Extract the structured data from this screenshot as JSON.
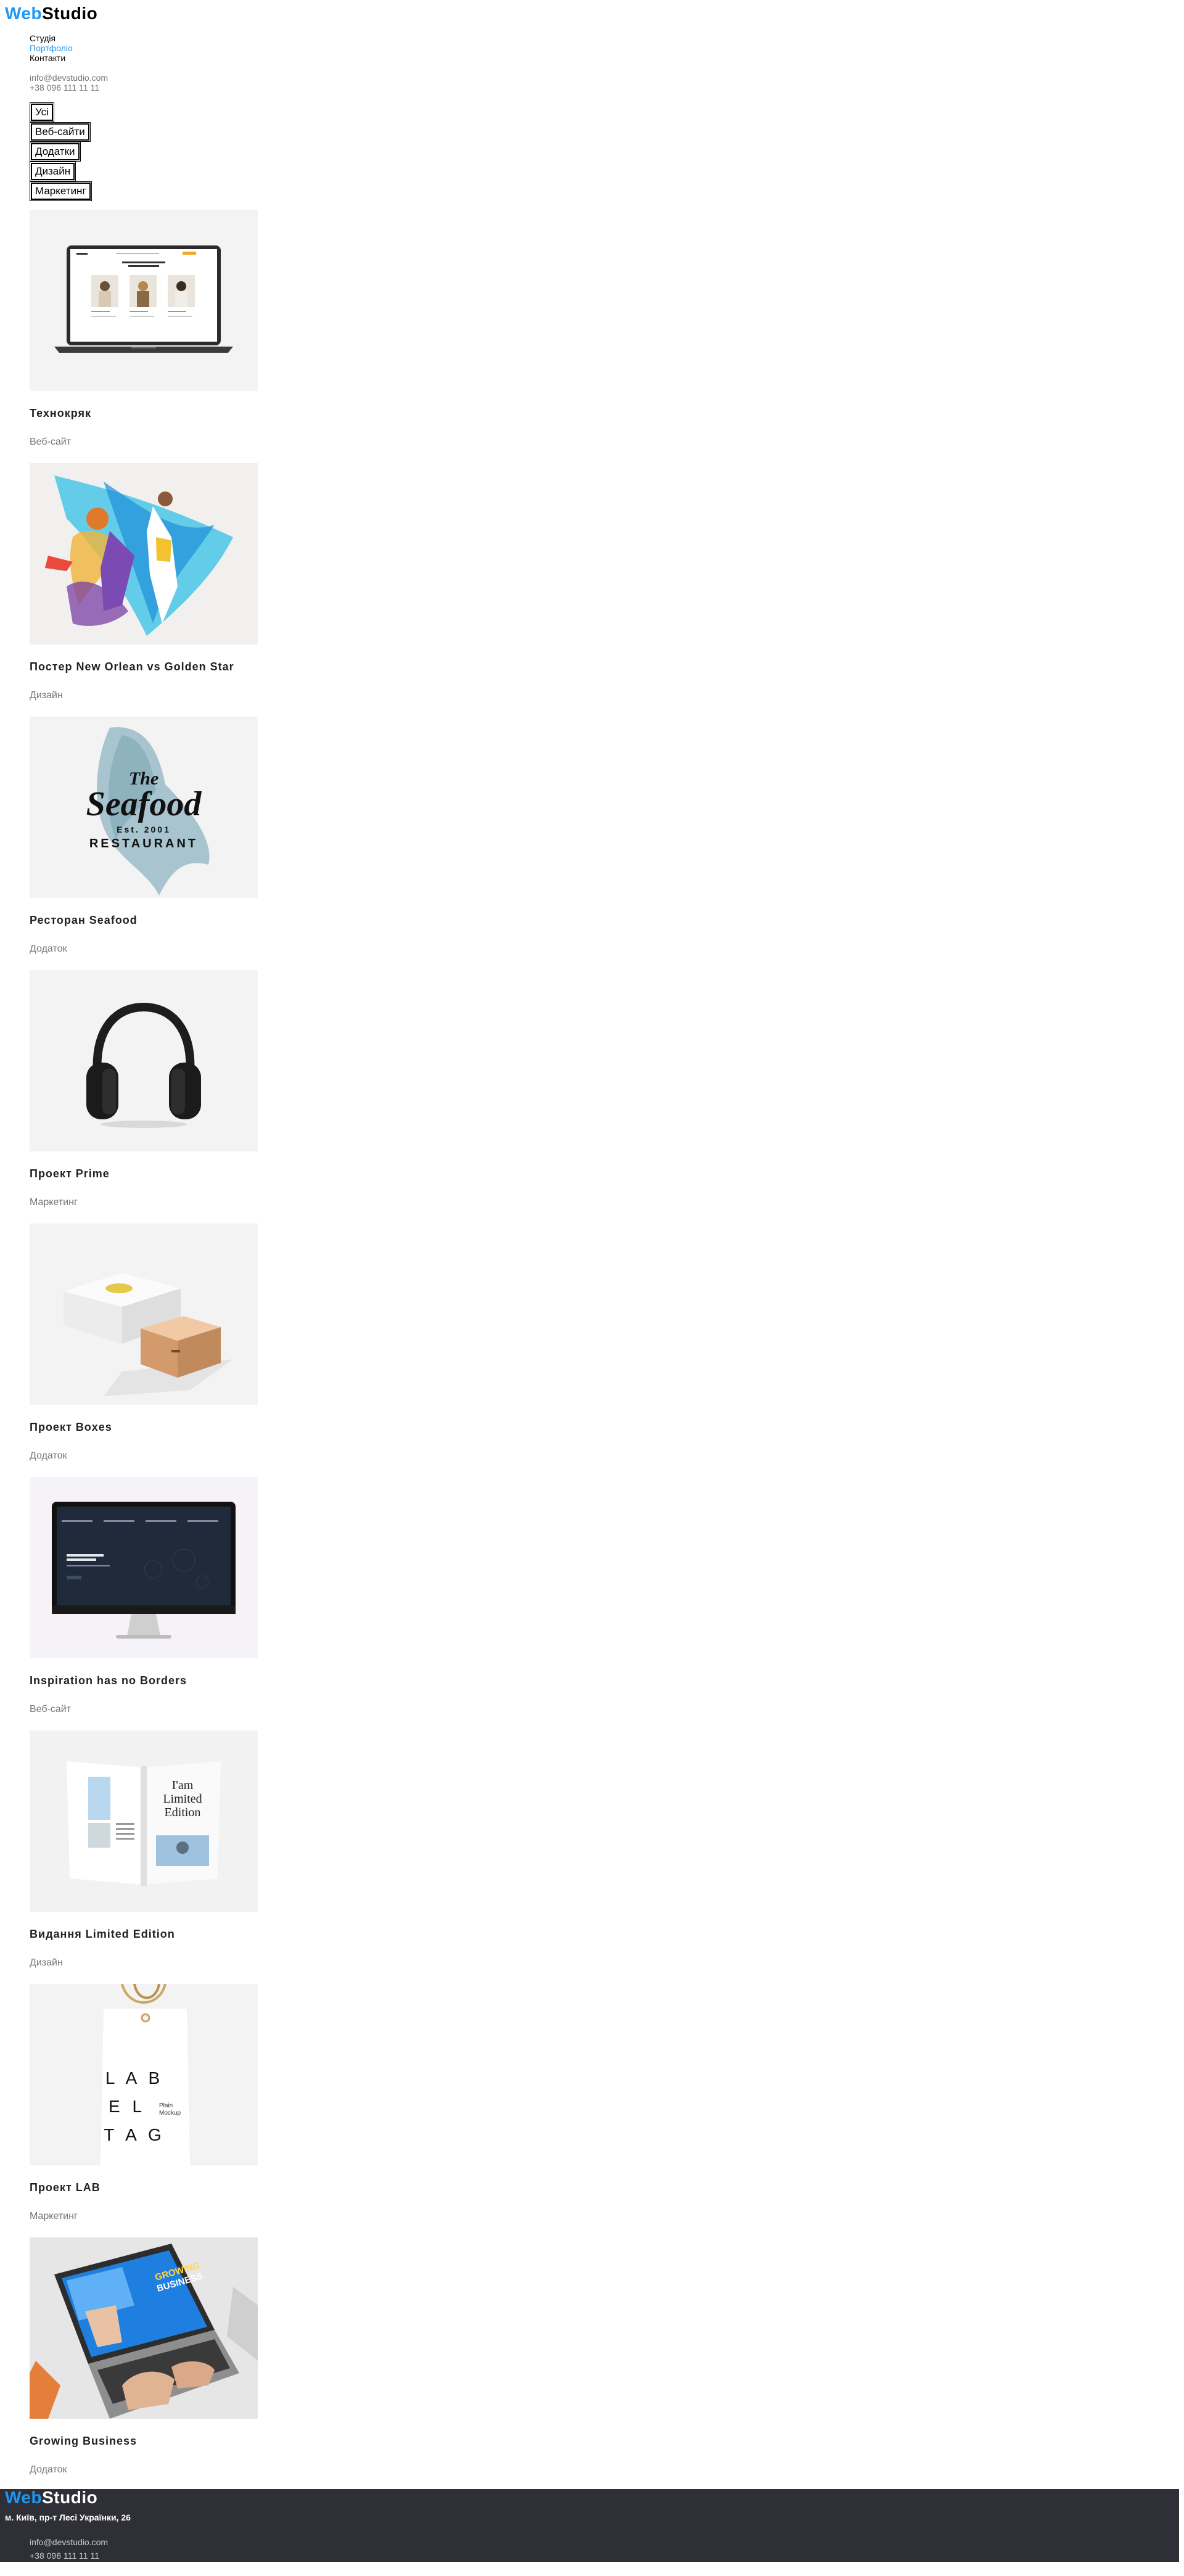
{
  "header": {
    "logo": {
      "part1": "Web",
      "part2": "Studio"
    },
    "nav": [
      "Студія",
      "Портфоліо",
      "Контакти"
    ],
    "contacts": {
      "email": "info@devstudio.com",
      "phone": "+38 096 111 11 11"
    }
  },
  "filters": [
    "Усі",
    "Веб-сайти",
    "Додатки",
    "Дизайн",
    "Маркетинг"
  ],
  "projects": [
    {
      "title": "Технокряк",
      "category": "Веб-сайт"
    },
    {
      "title": "Постер New Orlean vs Golden Star",
      "category": "Дизайн"
    },
    {
      "title": "Ресторан Seafood",
      "category": "Додаток"
    },
    {
      "title": "Проект Prime",
      "category": "Маркетинг"
    },
    {
      "title": "Проект Boxes",
      "category": "Додаток"
    },
    {
      "title": "Inspiration has no Borders",
      "category": "Веб-сайт"
    },
    {
      "title": "Видання Limited Edition",
      "category": "Дизайн"
    },
    {
      "title": "Проект LAB",
      "category": "Маркетинг"
    },
    {
      "title": "Growing Business",
      "category": "Додаток"
    }
  ],
  "images": {
    "seafood": {
      "word": "Seafood",
      "the": "The",
      "est": "Est. 2001",
      "sub": "RESTAURANT"
    },
    "magazine": {
      "line1": "I'am",
      "line2": "Limited",
      "line3": "Edition"
    },
    "tag": {
      "line1": "L A B",
      "line2": "E L",
      "line3": "T A G",
      "side1": "Plain",
      "side2": "Mockup"
    },
    "laptop": {
      "line1": "GROWING",
      "line2": "BUSINESS"
    }
  },
  "footer": {
    "logo": {
      "part1": "Web",
      "part2": "Studio"
    },
    "address": "м. Київ, пр-т Лесі Українки, 26",
    "email": "info@devstudio.com",
    "phone": "+38 096 111 11 11"
  },
  "colors": {
    "accent": "#2196f3",
    "footer_bg": "#2f2f37",
    "muted": "#757575"
  }
}
